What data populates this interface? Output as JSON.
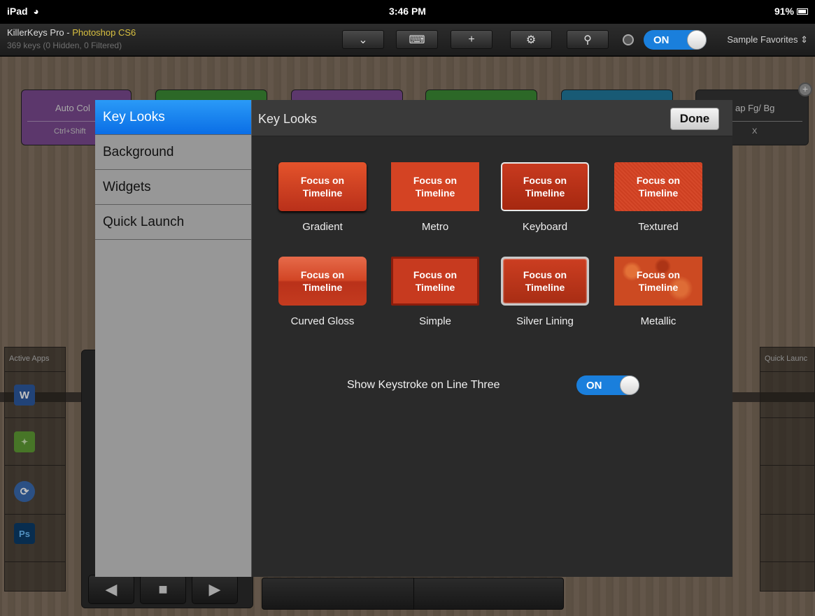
{
  "status_bar": {
    "device": "iPad",
    "time": "3:46 PM",
    "battery": "91%"
  },
  "app_bar": {
    "title_prefix": "KillerKeys Pro - ",
    "title_app": "Photoshop CS6",
    "subtitle": "369 keys (0 Hidden, 0 Filtered)",
    "toggle_label": "ON",
    "favorites_label": "Sample Favorites"
  },
  "background_keys": [
    {
      "label": "Auto Col",
      "shortcut": "Ctrl+Shift"
    },
    {
      "label": "ap Fg/ Bg",
      "shortcut": "X"
    }
  ],
  "side_panels": {
    "left_title": "Active Apps",
    "right_title": "Quick Launc",
    "apps": [
      "word-app",
      "gamerz-app",
      "killerkeys-app",
      "photoshop-app"
    ]
  },
  "modal": {
    "nav_items": [
      {
        "label": "Key Looks",
        "selected": true
      },
      {
        "label": "Background",
        "selected": false
      },
      {
        "label": "Widgets",
        "selected": false
      },
      {
        "label": "Quick Launch",
        "selected": false
      }
    ],
    "title": "Key Looks",
    "done_label": "Done",
    "swatch_text": [
      "Focus on",
      "Timeline"
    ],
    "looks": [
      {
        "name": "Gradient"
      },
      {
        "name": "Metro"
      },
      {
        "name": "Keyboard"
      },
      {
        "name": "Textured"
      },
      {
        "name": "Curved Gloss"
      },
      {
        "name": "Simple"
      },
      {
        "name": "Silver Lining"
      },
      {
        "name": "Metallic"
      }
    ],
    "keystroke_label": "Show Keystroke on Line Three",
    "keystroke_toggle": "ON"
  },
  "colors": {
    "accent_blue": "#1a7fdc",
    "key_red": "#cf3f22",
    "selected_nav": "#0a6ee6"
  }
}
